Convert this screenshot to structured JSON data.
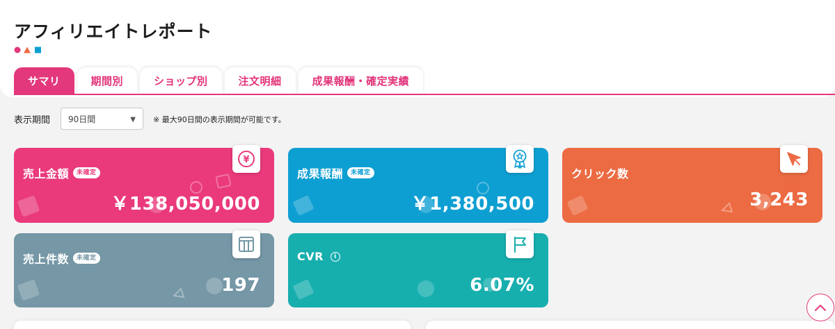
{
  "page": {
    "title": "アフィリエイトレポート"
  },
  "tabs": [
    {
      "label": "サマリ",
      "active": true
    },
    {
      "label": "期間別",
      "active": false
    },
    {
      "label": "ショップ別",
      "active": false
    },
    {
      "label": "注文明細",
      "active": false
    },
    {
      "label": "成果報酬・確定実績",
      "active": false
    }
  ],
  "filter": {
    "period_label": "表示期間",
    "period_value": "90日間",
    "note": "※ 最大90日間の表示期間が可能です。"
  },
  "cards": {
    "sales_amount": {
      "label": "売上金額",
      "badge": "未確定",
      "value": "￥138,050,000",
      "icon": "yen-icon",
      "color": "#ea3a7c"
    },
    "reward": {
      "label": "成果報酬",
      "badge": "未確定",
      "value": "￥1,380,500",
      "icon": "ribbon-star-icon",
      "color": "#0e9fd2"
    },
    "clicks": {
      "label": "クリック数",
      "value": "3,243",
      "icon": "cursor-icon",
      "color": "#ec6b43"
    },
    "sales_count": {
      "label": "売上件数",
      "badge": "未確定",
      "value": "197",
      "icon": "box-icon",
      "color": "#7597a6"
    },
    "cvr": {
      "label": "CVR",
      "value": "6.07%",
      "icon": "flag-icon",
      "color": "#17aeae"
    }
  },
  "colors": {
    "accent": "#e3387c"
  }
}
